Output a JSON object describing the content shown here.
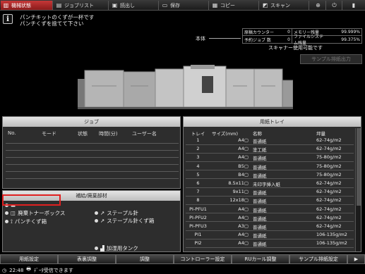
{
  "tabs": [
    {
      "label": "機械状態",
      "icon": "machine-icon"
    },
    {
      "label": "ジョブリスト",
      "icon": "list-icon"
    },
    {
      "label": "読出し",
      "icon": "folder-icon"
    },
    {
      "label": "保存",
      "icon": "save-icon"
    },
    {
      "label": "コピー",
      "icon": "copy-icon"
    },
    {
      "label": "スキャン",
      "icon": "scan-icon"
    },
    {
      "label": "",
      "icon": "globe-icon"
    },
    {
      "label": "",
      "icon": "power-icon"
    }
  ],
  "message": {
    "line1": "パンチキットのくずが一杯です",
    "line2": "パンチくずを捨てて下さい"
  },
  "honntai_label": "本体",
  "counters": [
    {
      "label": "原稿カウンター",
      "value": "0",
      "label2": "メモリー残量",
      "value2": "99.999%"
    },
    {
      "label": "予約ジョブ 数",
      "value": "0",
      "label2": "ファイルシステム残量",
      "value2": "99.375%"
    }
  ],
  "scanner_status": "スキャナー使用可能です",
  "sample_button": "サンプル排紙出力",
  "job_panel": {
    "title": "ジョブ",
    "headers": [
      "No.",
      "モード",
      "状態",
      "時間(分)",
      "ユーザー名"
    ]
  },
  "consumables": {
    "title": "補給/廃棄部材",
    "items": {
      "toner_waste": "廃棄トナーボックス",
      "punch_waste": "パンチくず箱",
      "staples": "ステープル針",
      "staple_waste": "ステープル針くず箱",
      "glue_tank": "加湿用タンク"
    }
  },
  "tray_panel": {
    "title": "用紙トレイ",
    "headers": [
      "トレイ",
      "サイズ(mm)",
      "名称",
      "坪量"
    ],
    "rows": [
      {
        "tray": "1",
        "size": "A4▢",
        "name": "普通紙",
        "weight": "62-74g/m2"
      },
      {
        "tray": "2",
        "size": "A4▢",
        "name": "塗工紙",
        "weight": "62-74g/m2"
      },
      {
        "tray": "3",
        "size": "A4▢",
        "name": "普通紙",
        "weight": "75-80g/m2"
      },
      {
        "tray": "4",
        "size": "B5▢",
        "name": "普通紙",
        "weight": "75-80g/m2"
      },
      {
        "tray": "5",
        "size": "B4▢",
        "name": "普通紙",
        "weight": "75-80g/m2"
      },
      {
        "tray": "6",
        "size": "8.5x11▢",
        "name": "未印字挿入紙",
        "weight": "62-74g/m2"
      },
      {
        "tray": "7",
        "size": "9x11▢",
        "name": "普通紙",
        "weight": "62-74g/m2"
      },
      {
        "tray": "8",
        "size": "12x18▢",
        "name": "普通紙",
        "weight": "62-74g/m2"
      },
      {
        "tray": "PI-PFU1",
        "size": "A4▢",
        "name": "普通紙",
        "weight": "62-74g/m2"
      },
      {
        "tray": "PI-PFU2",
        "size": "A4▢",
        "name": "普通紙",
        "weight": "62-74g/m2"
      },
      {
        "tray": "PI-PFU3",
        "size": "A3▢",
        "name": "普通紙",
        "weight": "62-74g/m2"
      },
      {
        "tray": "PI1",
        "size": "A4▢",
        "name": "普通紙",
        "weight": "106-135g/m2"
      },
      {
        "tray": "PI2",
        "size": "A4▢",
        "name": "普通紙",
        "weight": "106-135g/m2"
      }
    ]
  },
  "bottom_buttons": [
    "用紙設定",
    "表裏調整",
    "調整",
    "コントローラー設定",
    "RUカール調整",
    "サンプル排紙設定",
    "▶"
  ],
  "status_bar": {
    "time": "22:48",
    "text": "ﾃﾞｰﾀ受信できます"
  },
  "colors": {
    "active_tab": "#b42a2a",
    "highlight": "#e02020",
    "panel_bg": "#2d2d2d",
    "panel_title_bg": "#d0d0d0"
  }
}
